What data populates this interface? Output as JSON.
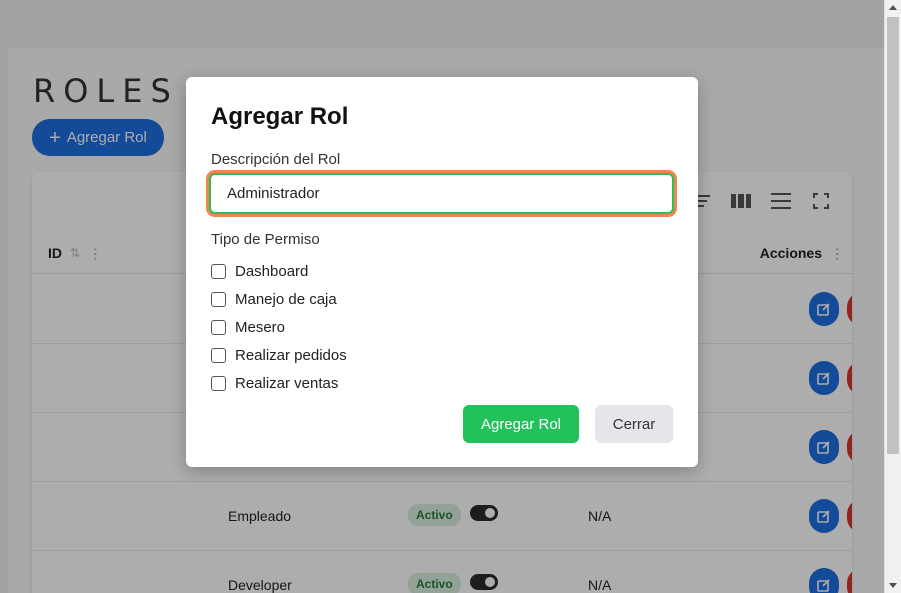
{
  "page": {
    "title": "ROLES",
    "add_button": "Agregar Rol"
  },
  "table": {
    "headers": {
      "id": "ID",
      "actions": "Acciones"
    },
    "rows": [
      {
        "name": "",
        "status": "",
        "other": ""
      },
      {
        "name": "",
        "status": "",
        "other": ""
      },
      {
        "name": "",
        "status": "",
        "other": ""
      },
      {
        "name": "Empleado",
        "status": "Activo",
        "other": "N/A"
      },
      {
        "name": "Developer",
        "status": "Activo",
        "other": "N/A"
      }
    ]
  },
  "modal": {
    "title": "Agregar Rol",
    "description_label": "Descripción del Rol",
    "description_value": "Administrador",
    "permissions_label": "Tipo de Permiso",
    "permissions": [
      {
        "label": "Dashboard",
        "checked": false
      },
      {
        "label": "Manejo de caja",
        "checked": false
      },
      {
        "label": "Mesero",
        "checked": false
      },
      {
        "label": "Realizar pedidos",
        "checked": false
      },
      {
        "label": "Realizar ventas",
        "checked": false
      }
    ],
    "submit_label": "Agregar Rol",
    "close_label": "Cerrar"
  },
  "colors": {
    "primary_blue": "#1e6fe0",
    "success_green": "#23c15c",
    "danger_red": "#d9342b",
    "focus_orange": "#f0874a"
  }
}
